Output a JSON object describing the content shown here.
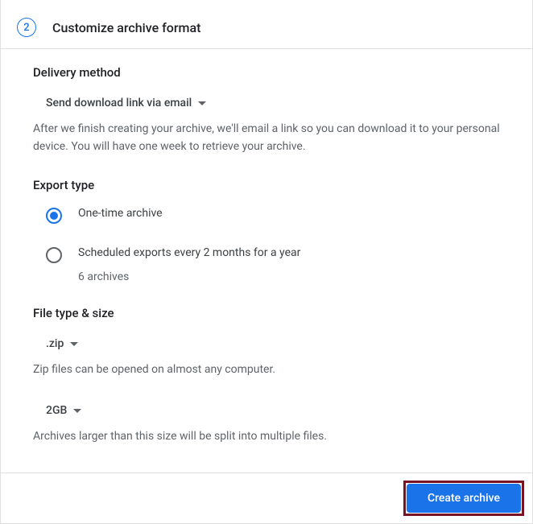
{
  "step": {
    "number": "2",
    "title": "Customize archive format"
  },
  "delivery": {
    "label": "Delivery method",
    "selected": "Send download link via email",
    "help": "After we finish creating your archive, we'll email a link so you can download it to your personal device. You will have one week to retrieve your archive."
  },
  "export": {
    "label": "Export type",
    "options": [
      {
        "label": "One-time archive",
        "selected": true
      },
      {
        "label": "Scheduled exports every 2 months for a year",
        "selected": false,
        "sub": "6 archives"
      }
    ]
  },
  "file": {
    "label": "File type & size",
    "type_selected": ".zip",
    "type_help": "Zip files can be opened on almost any computer.",
    "size_selected": "2GB",
    "size_help": "Archives larger than this size will be split into multiple files."
  },
  "actions": {
    "create": "Create archive"
  }
}
